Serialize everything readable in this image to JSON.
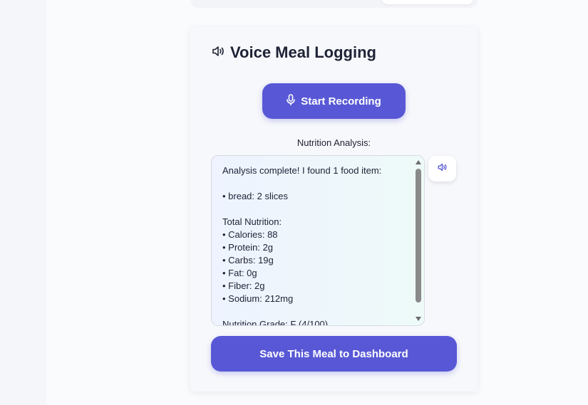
{
  "voice_card": {
    "title": "Voice Meal Logging",
    "title_icon": "speaker-icon",
    "record_button": {
      "label": "Start Recording",
      "icon": "microphone-icon"
    },
    "analysis_label": "Nutrition Analysis:",
    "analysis_text": "Analysis complete! I found 1 food item:\n\n• bread: 2 slices\n\nTotal Nutrition:\n• Calories: 88\n• Protein: 2g\n• Carbs: 19g\n• Fat: 0g\n• Fiber: 2g\n• Sodium: 212mg\n\nNutrition Grade: F (4/100)",
    "speak_button_icon": "speaker-icon",
    "save_button_label": "Save This Meal to Dashboard"
  },
  "colors": {
    "accent": "#5858d6",
    "text": "#1e2235",
    "card_bg": "#f7f8fb"
  }
}
